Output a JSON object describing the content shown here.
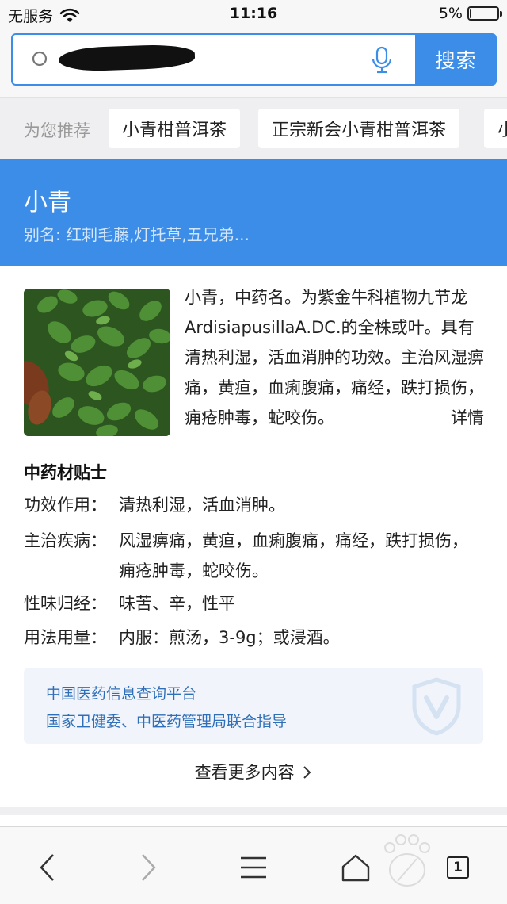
{
  "status_bar": {
    "carrier": "无服务",
    "time": "11:16",
    "battery": "5%",
    "battery_level": 0.05
  },
  "search": {
    "button_label": "搜索"
  },
  "recommend": {
    "label": "为您推荐",
    "chips": [
      "小青柑普洱茶",
      "正宗新会小青柑普洱茶",
      "小"
    ]
  },
  "hero": {
    "title": "小青",
    "alias": "别名: 红刺毛藤,灯托草,五兄弟..."
  },
  "intro": {
    "text": "小青，中药名。为紫金牛科植物九节龙ArdisiapusillaA.DC.的全株或叶。具有清热利湿，活血消肿的功效。主治风湿痹痛，黄疸，血痢腹痛，痛经，跌打损伤，痈疮肿毒，蛇咬伤。",
    "more": "详情"
  },
  "tips": {
    "title": "中药材贴士",
    "rows": [
      {
        "key": "功效作用：",
        "value": "清热利湿，活血消肿。"
      },
      {
        "key": "主治疾病：",
        "value": "风湿痹痛，黄疸，血痢腹痛，痛经，跌打损伤，痈疮肿毒，蛇咬伤。"
      },
      {
        "key": "性味归经：",
        "value": "味苦、辛，性平"
      },
      {
        "key": "用法用量：",
        "value": "内服：煎汤，3-9g；或浸酒。"
      }
    ]
  },
  "source": {
    "line1": "中国医药信息查询平台",
    "line2": "国家卫健委、中医药管理局联合指导"
  },
  "see_more": "查看更多内容",
  "toolbar": {
    "tab_count": "1"
  },
  "colors": {
    "accent": "#3b8de8",
    "source_text": "#2f6fb8"
  }
}
